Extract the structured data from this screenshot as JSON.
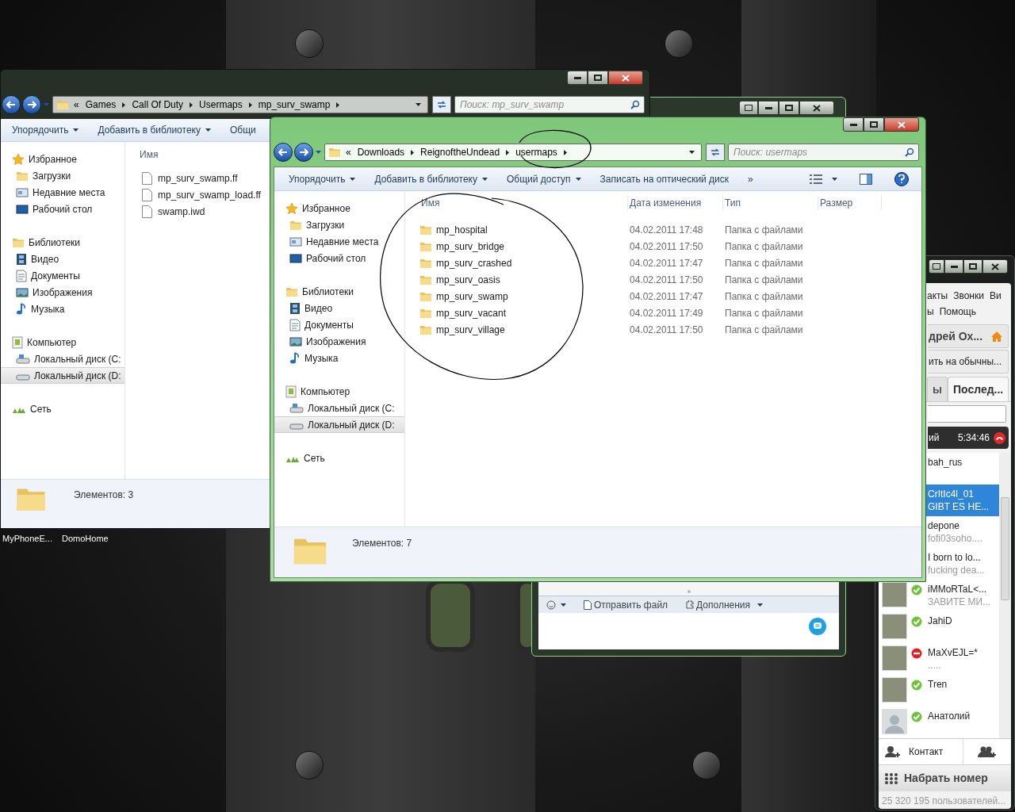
{
  "desktop": {
    "icons": [
      "MyPhoneE...",
      "DomoHome"
    ]
  },
  "back_explorer": {
    "breadcrumb_overflow": "«",
    "breadcrumb": [
      "Games",
      "Call Of Duty",
      "Usermaps",
      "mp_surv_swamp"
    ],
    "search": {
      "placeholder": "Поиск: mp_surv_swamp"
    },
    "toolbar": [
      {
        "label": "Упорядочить",
        "dropdown": true
      },
      {
        "label": "Добавить в библиотеку",
        "dropdown": true
      },
      {
        "label": "Общи",
        "dropdown": false
      }
    ],
    "nav": [
      {
        "label": "Избранное",
        "kind": "favorites",
        "children": [
          {
            "label": "Загрузки",
            "kind": "downloads",
            "selected": false
          },
          {
            "label": "Недавние места",
            "kind": "recent",
            "selected": false
          },
          {
            "label": "Рабочий стол",
            "kind": "desktop",
            "selected": false
          }
        ]
      },
      {
        "label": "Библиотеки",
        "kind": "libraries",
        "children": [
          {
            "label": "Видео",
            "kind": "video",
            "selected": false
          },
          {
            "label": "Документы",
            "kind": "documents",
            "selected": false
          },
          {
            "label": "Изображения",
            "kind": "images",
            "selected": false
          },
          {
            "label": "Музыка",
            "kind": "music",
            "selected": false
          }
        ]
      },
      {
        "label": "Компьютер",
        "kind": "computer",
        "children": [
          {
            "label": "Локальный диск (C:",
            "kind": "disk_c",
            "selected": false
          },
          {
            "label": "Локальный диск (D:",
            "kind": "disk_d",
            "selected": true
          }
        ]
      },
      {
        "label": "Сеть",
        "kind": "network"
      }
    ],
    "columns": [
      "Имя"
    ],
    "files": [
      {
        "name": "mp_surv_swamp.ff"
      },
      {
        "name": "mp_surv_swamp_load.ff"
      },
      {
        "name": "swamp.iwd"
      }
    ],
    "status": "Элементов: 3"
  },
  "skype_chat": {
    "toolbar": [
      "Отправить файл",
      "Дополнения"
    ]
  },
  "main_explorer": {
    "breadcrumb_overflow": "«",
    "breadcrumb": [
      "Downloads",
      "ReignoftheUndead",
      "usermaps"
    ],
    "search": {
      "placeholder": "Поиск: usermaps"
    },
    "toolbar": [
      {
        "label": "Упорядочить",
        "dropdown": true
      },
      {
        "label": "Добавить в библиотеку",
        "dropdown": true
      },
      {
        "label": "Общий доступ",
        "dropdown": true
      },
      {
        "label": "Записать на оптический диск",
        "dropdown": false
      },
      {
        "label": "»",
        "dropdown": false
      }
    ],
    "nav": [
      {
        "label": "Избранное",
        "kind": "favorites",
        "children": [
          {
            "label": "Загрузки",
            "kind": "downloads",
            "selected": false
          },
          {
            "label": "Недавние места",
            "kind": "recent",
            "selected": false
          },
          {
            "label": "Рабочий стол",
            "kind": "desktop",
            "selected": false
          }
        ]
      },
      {
        "label": "Библиотеки",
        "kind": "libraries",
        "children": [
          {
            "label": "Видео",
            "kind": "video",
            "selected": false
          },
          {
            "label": "Документы",
            "kind": "documents",
            "selected": false
          },
          {
            "label": "Изображения",
            "kind": "images",
            "selected": false
          },
          {
            "label": "Музыка",
            "kind": "music",
            "selected": false
          }
        ]
      },
      {
        "label": "Компьютер",
        "kind": "computer",
        "children": [
          {
            "label": "Локальный диск (C:",
            "kind": "disk_c",
            "selected": false
          },
          {
            "label": "Локальный диск (D:",
            "kind": "disk_d",
            "selected": true
          }
        ]
      },
      {
        "label": "Сеть",
        "kind": "network"
      }
    ],
    "columns": [
      "Имя",
      "Дата изменения",
      "Тип",
      "Размер"
    ],
    "rows": [
      {
        "name": "mp_hospital",
        "date": "04.02.2011 17:48",
        "type": "Папка с файлами"
      },
      {
        "name": "mp_surv_bridge",
        "date": "04.02.2011 17:50",
        "type": "Папка с файлами"
      },
      {
        "name": "mp_surv_crashed",
        "date": "04.02.2011 17:47",
        "type": "Папка с файлами"
      },
      {
        "name": "mp_surv_oasis",
        "date": "04.02.2011 17:50",
        "type": "Папка с файлами"
      },
      {
        "name": "mp_surv_swamp",
        "date": "04.02.2011 17:47",
        "type": "Папка с файлами"
      },
      {
        "name": "mp_surv_vacant",
        "date": "04.02.2011 17:49",
        "type": "Папка с файлами"
      },
      {
        "name": "mp_surv_village",
        "date": "04.02.2011 17:50",
        "type": "Папка с файлами"
      }
    ],
    "status": "Элементов: 7"
  },
  "skype_contacts": {
    "menu": [
      [
        "акты",
        "Звонки",
        "Ви"
      ],
      [
        "ы",
        "Помощь"
      ]
    ],
    "profile_name": "дрей Ох...",
    "mode_button": "ить на обычны...",
    "tabs": [
      {
        "label": "ы",
        "selected": false
      },
      {
        "label": "Послед...",
        "selected": true
      }
    ],
    "call": {
      "name": "ий",
      "time": "5:34:46"
    },
    "contacts": [
      {
        "name": "bah_rus",
        "selected": false
      },
      {
        "name": "CrItIc4l_01",
        "mood": "GIBT ES HE...",
        "selected": true
      },
      {
        "name": "depone",
        "mood": "fofi03soho....",
        "selected": false
      },
      {
        "name": "I born to lo...",
        "mood": "fucking dea...",
        "selected": false
      },
      {
        "name": "iMMoRTaL<...",
        "mood": "ЗАВИТЕ МИ...",
        "kind": "online",
        "photo": true,
        "selected": false
      },
      {
        "name": "JahiD",
        "kind": "online",
        "photo": true,
        "selected": false
      },
      {
        "name": "MaXvEJL=*",
        "mood": ".....",
        "kind": "busy",
        "photo": true,
        "selected": false
      },
      {
        "name": "Tren",
        "kind": "online",
        "photo": true,
        "selected": false
      },
      {
        "name": "Анатолий",
        "kind": "online",
        "photo": false,
        "selected": false
      }
    ],
    "add_contact": "Контакт",
    "dial": "Набрать номер",
    "users_online": "25 320 195 пользователей..."
  }
}
